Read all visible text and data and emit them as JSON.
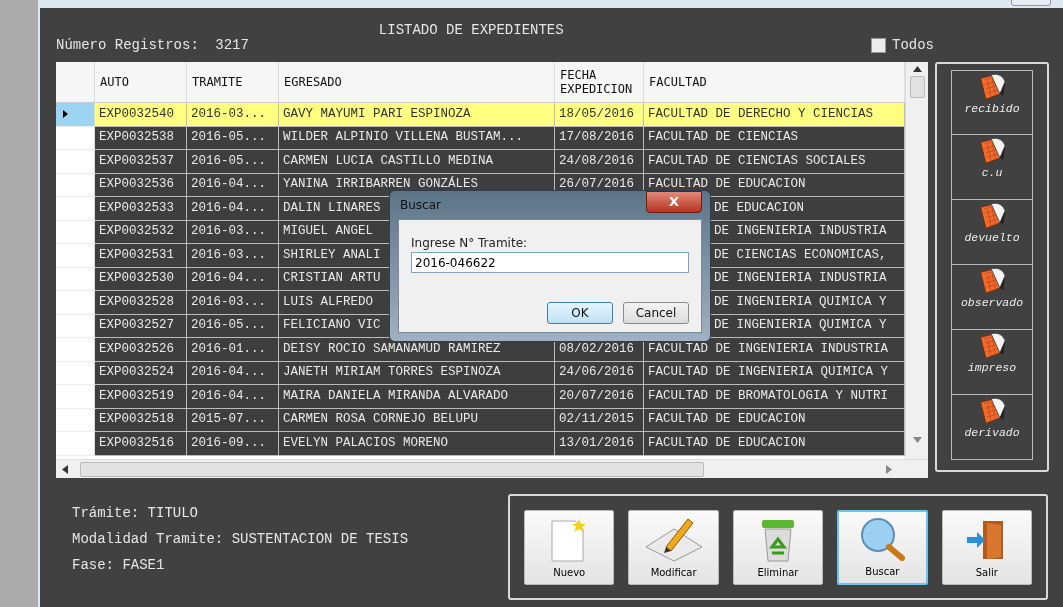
{
  "header": {
    "count_label": "Número Registros:",
    "count": "3217",
    "title": "LISTADO DE EXPEDIENTES",
    "todos": {
      "label": "Todos",
      "checked": false
    }
  },
  "table": {
    "columns": [
      "AUTO",
      "TRAMITE",
      "EGRESADO",
      "FECHA EXPEDICION",
      "FACULTAD"
    ],
    "rows": [
      {
        "kind": "full",
        "selected": true,
        "cells": [
          "EXP0032540",
          "2016-03...",
          "GAVY MAYUMI PARI ESPINOZA",
          "18/05/2016",
          "FACULTAD DE DERECHO Y CIENCIAS"
        ]
      },
      {
        "kind": "full",
        "selected": false,
        "cells": [
          "EXP0032538",
          "2016-05...",
          "WILDER ALPINIO VILLENA BUSTAM...",
          "17/08/2016",
          "FACULTAD DE CIENCIAS"
        ]
      },
      {
        "kind": "full",
        "selected": false,
        "cells": [
          "EXP0032537",
          "2016-05...",
          "CARMEN LUCIA CASTILLO MEDINA",
          "24/08/2016",
          "FACULTAD DE CIENCIAS SOCIALES"
        ]
      },
      {
        "kind": "full",
        "selected": false,
        "cells": [
          "EXP0032536",
          "2016-04...",
          "YANINA IRRIBARREN GONZÁLES",
          "26/07/2016",
          "FACULTAD DE EDUCACION"
        ]
      },
      {
        "kind": "covered",
        "selected": false,
        "cells": [
          "EXP0032533",
          "2016-04...",
          "DALIN LINARES",
          "",
          "DE EDUCACION"
        ]
      },
      {
        "kind": "covered",
        "selected": false,
        "cells": [
          "EXP0032532",
          "2016-03...",
          "MIGUEL ANGEL",
          "",
          "DE INGENIERIA INDUSTRIA"
        ]
      },
      {
        "kind": "covered",
        "selected": false,
        "cells": [
          "EXP0032531",
          "2016-03...",
          "SHIRLEY ANALI",
          "",
          "DE CIENCIAS ECONOMICAS,"
        ]
      },
      {
        "kind": "covered",
        "selected": false,
        "cells": [
          "EXP0032530",
          "2016-04...",
          "CRISTIAN ARTU",
          "",
          "DE INGENIERIA INDUSTRIA"
        ]
      },
      {
        "kind": "covered",
        "selected": false,
        "cells": [
          "EXP0032528",
          "2016-03...",
          "LUIS ALFREDO",
          "",
          "DE INGENIERIA QUIMICA Y"
        ]
      },
      {
        "kind": "covered",
        "selected": false,
        "cells": [
          "EXP0032527",
          "2016-05...",
          "FELICIANO VIC",
          "",
          "DE INGENIERIA QUIMICA Y"
        ]
      },
      {
        "kind": "full",
        "selected": false,
        "cells": [
          "EXP0032526",
          "2016-01...",
          "DEISY ROCIO SAMANAMUD RAMIREZ",
          "08/02/2016",
          "FACULTAD DE INGENIERIA INDUSTRIA"
        ]
      },
      {
        "kind": "full",
        "selected": false,
        "cells": [
          "EXP0032524",
          "2016-04...",
          "JANETH MIRIAM TORRES ESPINOZA",
          "24/06/2016",
          "FACULTAD DE INGENIERIA QUIMICA Y"
        ]
      },
      {
        "kind": "full",
        "selected": false,
        "cells": [
          "EXP0032519",
          "2016-04...",
          "MAIRA DANIELA MIRANDA ALVARADO",
          "20/07/2016",
          "FACULTAD DE BROMATOLOGIA Y NUTRI"
        ]
      },
      {
        "kind": "full",
        "selected": false,
        "cells": [
          "EXP0032518",
          "2015-07...",
          "CARMEN ROSA CORNEJO BELUPU",
          "02/11/2015",
          "FACULTAD DE EDUCACION"
        ]
      },
      {
        "kind": "full",
        "selected": false,
        "cells": [
          "EXP0032516",
          "2016-09...",
          "EVELYN PALACIOS MORENO",
          "13/01/2016",
          "FACULTAD DE EDUCACION"
        ]
      }
    ]
  },
  "dialog": {
    "title": "Buscar",
    "close": "X",
    "label": "Ingrese N° Tramite:",
    "value": "2016-046622",
    "buttons": [
      "OK",
      "Cancel"
    ]
  },
  "states": [
    "recibido",
    "c.u",
    "devuelto",
    "observado",
    "impreso",
    "derivado"
  ],
  "info": [
    "Trámite: TITULO",
    "Modalidad Tramite: SUSTENTACION DE TESIS",
    "Fase: FASE1"
  ],
  "actions": [
    {
      "kind": "new",
      "label": "Nuevo",
      "selected": false
    },
    {
      "kind": "edit",
      "label": "Modificar",
      "selected": false
    },
    {
      "kind": "delete",
      "label": "Eliminar",
      "selected": false
    },
    {
      "kind": "search",
      "label": "Buscar",
      "selected": true
    },
    {
      "kind": "exit",
      "label": "Salir",
      "selected": false
    }
  ]
}
